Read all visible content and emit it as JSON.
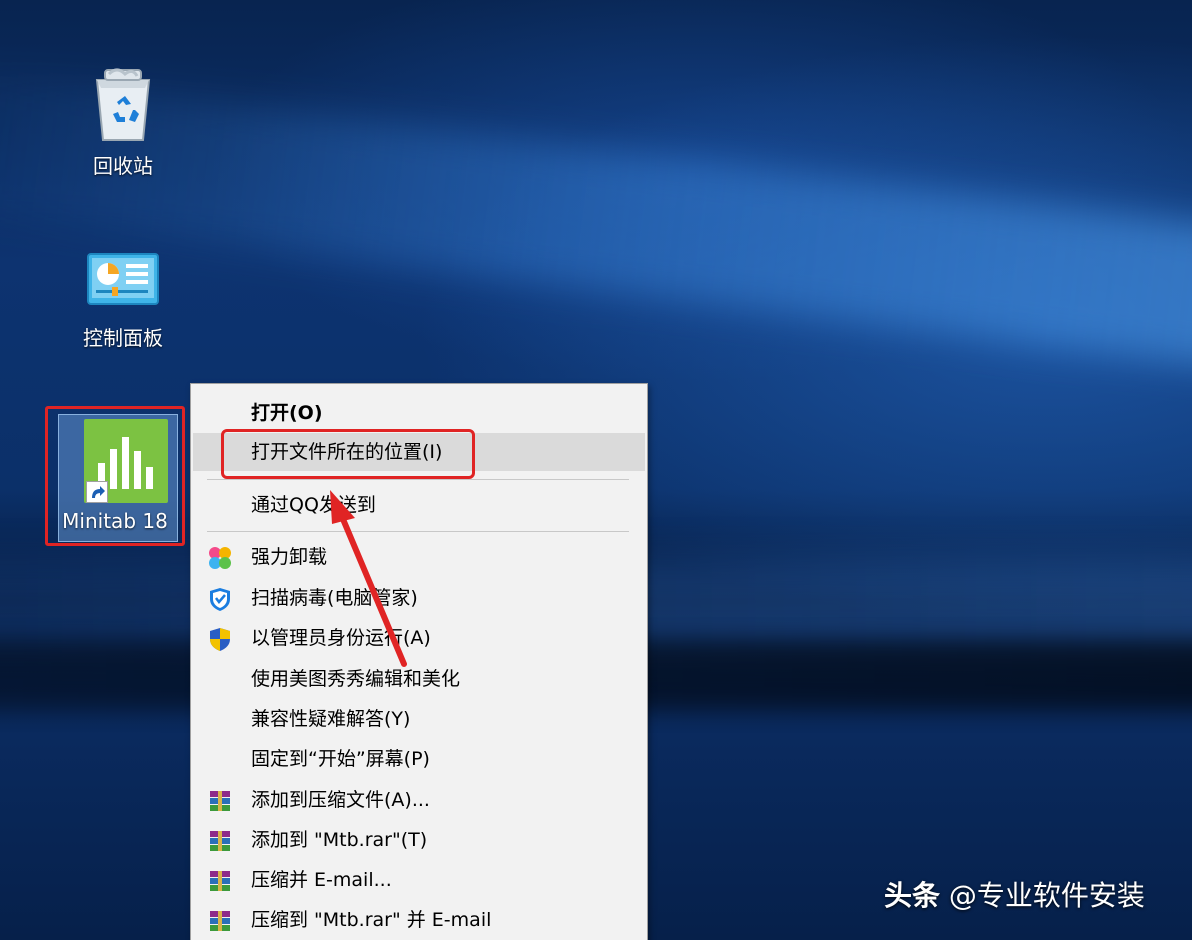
{
  "desktop": {
    "icons": [
      {
        "label": "回收站",
        "icon": "recycle-bin-icon"
      },
      {
        "label": "控制面板",
        "icon": "control-panel-icon"
      },
      {
        "label": "Minitab 18",
        "icon": "minitab-icon",
        "selected": true
      }
    ]
  },
  "context_menu": {
    "items": [
      {
        "label": "打开(O)",
        "icon": null,
        "bold": true
      },
      {
        "label": "打开文件所在的位置(I)",
        "icon": null,
        "hover": true,
        "highlighted": true
      },
      {
        "label": "通过QQ发送到",
        "icon": null
      },
      {
        "label": "强力卸载",
        "icon": "clover-icon"
      },
      {
        "label": "扫描病毒(电脑管家)",
        "icon": "shield-icon"
      },
      {
        "label": "以管理员身份运行(A)",
        "icon": "uac-shield-icon"
      },
      {
        "label": "使用美图秀秀编辑和美化",
        "icon": null
      },
      {
        "label": "兼容性疑难解答(Y)",
        "icon": null
      },
      {
        "label": "固定到“开始”屏幕(P)",
        "icon": null
      },
      {
        "label": "添加到压缩文件(A)...",
        "icon": "winrar-icon"
      },
      {
        "label": "添加到 \"Mtb.rar\"(T)",
        "icon": "winrar-icon"
      },
      {
        "label": "压缩并 E-mail...",
        "icon": "winrar-icon"
      },
      {
        "label": "压缩到 \"Mtb.rar\" 并 E-mail",
        "icon": "winrar-icon"
      }
    ]
  },
  "watermark": {
    "prefix": "头条",
    "author": "@专业软件安装"
  },
  "colors": {
    "annotation_red": "#e02424",
    "menu_bg": "#f2f2f2",
    "menu_hover": "#dadada",
    "minitab_green": "#7cc242"
  }
}
